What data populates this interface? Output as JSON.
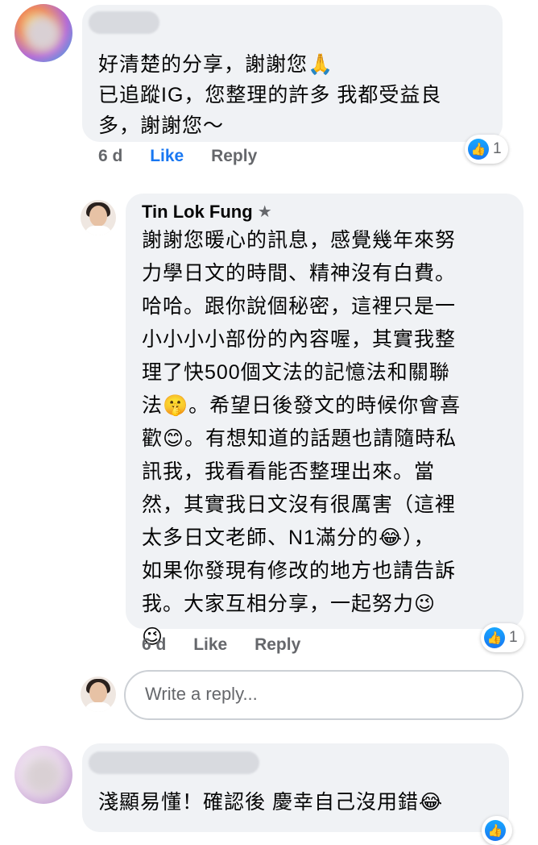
{
  "comment1": {
    "text_lines": [
      "好清楚的分享，謝謝您🙏",
      "已追蹤IG，您整理的許多 我都受益良",
      "多，謝謝您～"
    ],
    "age": "6 d",
    "like_label": "Like",
    "reply_label": "Reply",
    "reaction_count": "1"
  },
  "reply1": {
    "author": "Tin Lok Fung",
    "text_lines": [
      "謝謝您暖心的訊息，感覺幾年來努",
      "力學日文的時間、精神沒有白費。",
      "哈哈。跟你說個秘密，這裡只是一",
      "小小小小部份的內容喔，其實我整",
      "理了快500個文法的記憶法和關聯",
      "法🤫。希望日後發文的時候你會喜",
      "歡😊。有想知道的話題也請隨時私",
      "訊我，我看看能否整理出來。當",
      "然，其實我日文沒有很厲害（這裡",
      "太多日文老師、N1滿分的😂），",
      "如果你發現有修改的地方也請告訴",
      "我。大家互相分享，一起努力😉",
      "😉"
    ],
    "age": "6 d",
    "like_label": "Like",
    "reply_label": "Reply",
    "reaction_count": "1"
  },
  "reply_box": {
    "placeholder": "Write a reply..."
  },
  "comment2": {
    "text_lines": [
      "淺顯易懂！確認後 慶幸自己沒用錯😂"
    ]
  },
  "colors": {
    "bubble": "#f0f2f5",
    "meta_gray": "#65676b",
    "like_blue": "#1877f2"
  },
  "icons": [
    "avatar",
    "pin-star-icon",
    "like-reaction-icon"
  ]
}
